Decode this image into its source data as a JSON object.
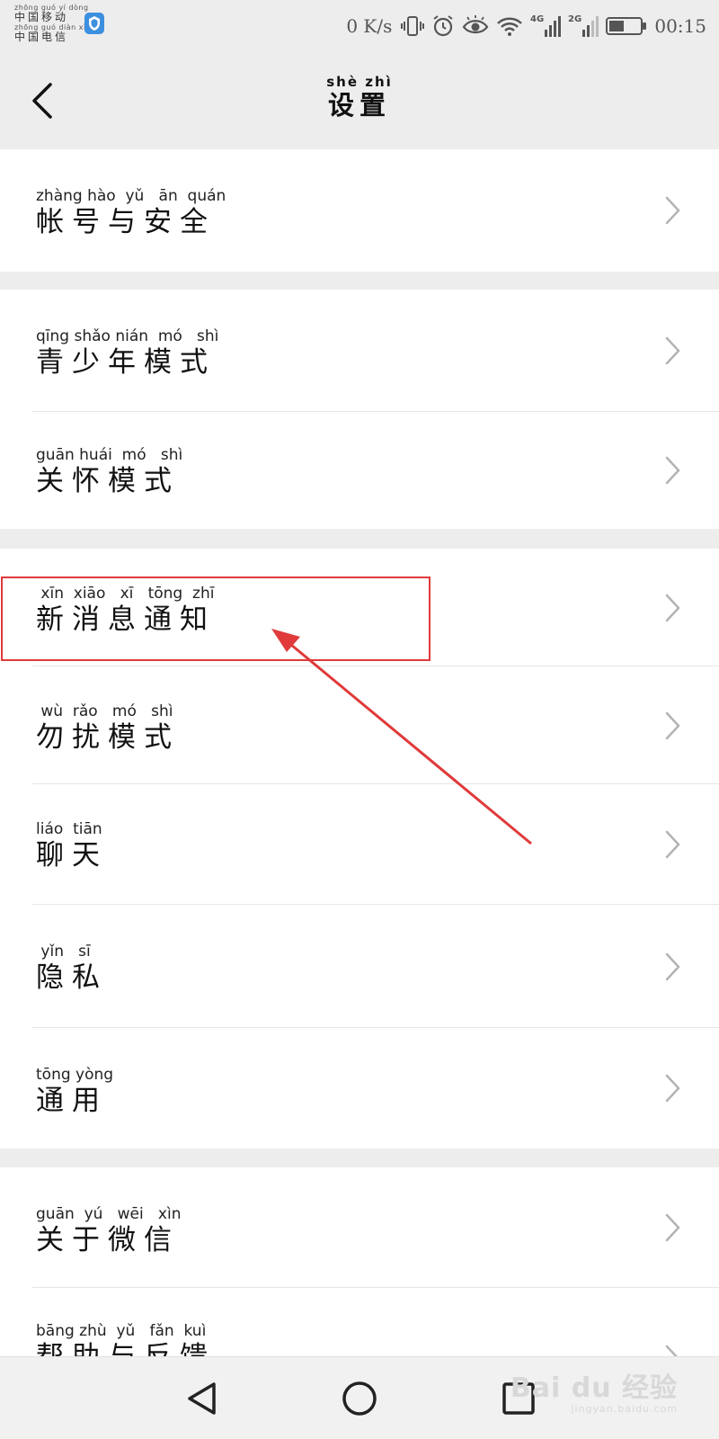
{
  "status_bar": {
    "carrier_1_pinyin": "zhōng guó  yí  dòng",
    "carrier_1": "中国移动",
    "carrier_2_pinyin": "zhōng guó diàn  xìn",
    "carrier_2": "中国电信",
    "net_speed": "0 K/s",
    "signal_1": "4G",
    "signal_2": "2G",
    "time": "00:15"
  },
  "header": {
    "title_pinyin": "shè  zhì",
    "title": "设置",
    "back_icon": "chevron-left-icon"
  },
  "groups": [
    {
      "items": [
        {
          "pinyin": "zhàng hào  yǔ   ān  quán",
          "label": "帐号与安全"
        }
      ]
    },
    {
      "items": [
        {
          "pinyin": "qīng shǎo nián  mó   shì",
          "label": "青少年模式"
        },
        {
          "pinyin": "guān huái  mó   shì",
          "label": "关怀模式"
        }
      ]
    },
    {
      "items": [
        {
          "pinyin": " xīn  xiāo   xī   tōng  zhī",
          "label": "新消息通知"
        },
        {
          "pinyin": " wù  rǎo   mó   shì",
          "label": "勿扰模式"
        },
        {
          "pinyin": "liáo  tiān",
          "label": "聊天"
        },
        {
          "pinyin": " yǐn   sī",
          "label": "隐私"
        },
        {
          "pinyin": "tōng yòng",
          "label": "通用"
        }
      ]
    },
    {
      "items": [
        {
          "pinyin": "guān  yú   wēi   xìn",
          "label": "关于微信"
        },
        {
          "pinyin": "bāng zhù  yǔ   fǎn  kuì",
          "label": "帮助与反馈"
        }
      ]
    }
  ],
  "annotation": {
    "highlighted_item": "新消息通知",
    "color": "#e03a3a"
  },
  "nav_bar": {
    "back": "triangle-back-icon",
    "home": "circle-home-icon",
    "recents": "square-recents-icon"
  },
  "watermark": {
    "main": "Bai du 经验",
    "sub": "jingyan.baidu.com"
  },
  "colors": {
    "background": "#ededed",
    "card": "#ffffff",
    "highlight": "#e03a3a"
  }
}
